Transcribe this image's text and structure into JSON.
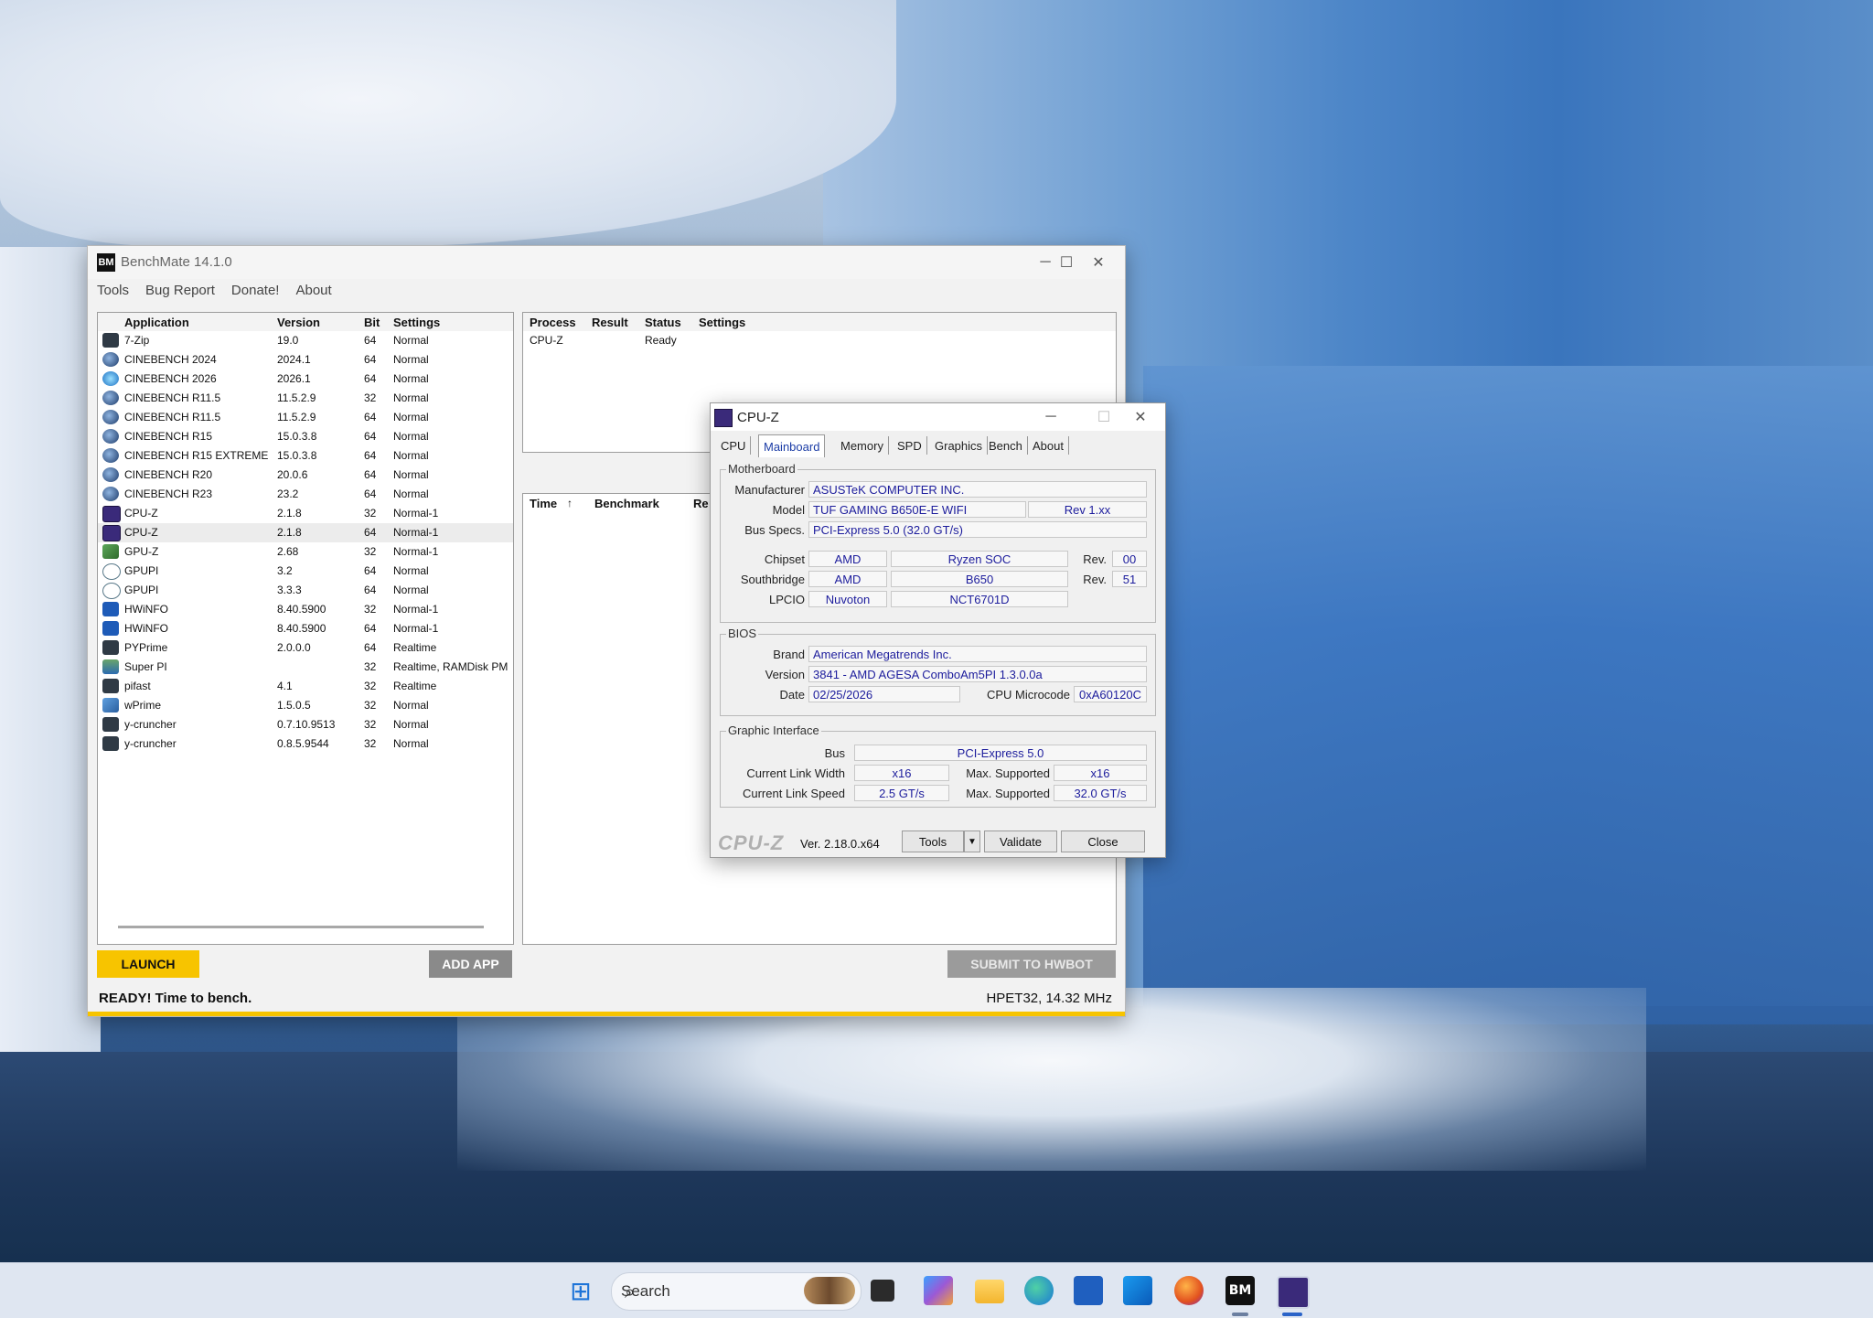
{
  "benchmate": {
    "title": "BenchMate 14.1.0",
    "menu": [
      "Tools",
      "Bug Report",
      "Donate!",
      "About"
    ],
    "apps_headers": [
      "Application",
      "Version",
      "Bit",
      "Settings"
    ],
    "apps": [
      {
        "name": "7-Zip",
        "version": "19.0",
        "bit": "64",
        "settings": "Normal",
        "icon": "terminal"
      },
      {
        "name": "CINEBENCH 2024",
        "version": "2024.1",
        "bit": "64",
        "settings": "Normal",
        "icon": "cinebench"
      },
      {
        "name": "CINEBENCH 2026",
        "version": "2026.1",
        "bit": "64",
        "settings": "Normal",
        "icon": "cinebench-new"
      },
      {
        "name": "CINEBENCH R11.5",
        "version": "11.5.2.9",
        "bit": "32",
        "settings": "Normal",
        "icon": "cinebench"
      },
      {
        "name": "CINEBENCH R11.5",
        "version": "11.5.2.9",
        "bit": "64",
        "settings": "Normal",
        "icon": "cinebench"
      },
      {
        "name": "CINEBENCH R15",
        "version": "15.0.3.8",
        "bit": "64",
        "settings": "Normal",
        "icon": "cinebench"
      },
      {
        "name": "CINEBENCH R15 EXTREME",
        "version": "15.0.3.8",
        "bit": "64",
        "settings": "Normal",
        "icon": "cinebench"
      },
      {
        "name": "CINEBENCH R20",
        "version": "20.0.6",
        "bit": "64",
        "settings": "Normal",
        "icon": "cinebench"
      },
      {
        "name": "CINEBENCH R23",
        "version": "23.2",
        "bit": "64",
        "settings": "Normal",
        "icon": "cinebench"
      },
      {
        "name": "CPU-Z",
        "version": "2.1.8",
        "bit": "32",
        "settings": "Normal-1",
        "icon": "cpuz"
      },
      {
        "name": "CPU-Z",
        "version": "2.1.8",
        "bit": "64",
        "settings": "Normal-1",
        "icon": "cpuz"
      },
      {
        "name": "GPU-Z",
        "version": "2.68",
        "bit": "32",
        "settings": "Normal-1",
        "icon": "gpuz"
      },
      {
        "name": "GPUPI",
        "version": "3.2",
        "bit": "64",
        "settings": "Normal",
        "icon": "pi"
      },
      {
        "name": "GPUPI",
        "version": "3.3.3",
        "bit": "64",
        "settings": "Normal",
        "icon": "pi"
      },
      {
        "name": "HWiNFO",
        "version": "8.40.5900",
        "bit": "32",
        "settings": "Normal-1",
        "icon": "hwinfo"
      },
      {
        "name": "HWiNFO",
        "version": "8.40.5900",
        "bit": "64",
        "settings": "Normal-1",
        "icon": "hwinfo"
      },
      {
        "name": "PYPrime",
        "version": "2.0.0.0",
        "bit": "64",
        "settings": "Realtime",
        "icon": "terminal"
      },
      {
        "name": "Super PI",
        "version": "",
        "bit": "32",
        "settings": "Realtime, RAMDisk PM",
        "icon": "superpi"
      },
      {
        "name": "pifast",
        "version": "4.1",
        "bit": "32",
        "settings": "Realtime",
        "icon": "terminal"
      },
      {
        "name": "wPrime",
        "version": "1.5.0.5",
        "bit": "32",
        "settings": "Normal",
        "icon": "wprime"
      },
      {
        "name": "y-cruncher",
        "version": "0.7.10.9513",
        "bit": "32",
        "settings": "Normal",
        "icon": "terminal"
      },
      {
        "name": "y-cruncher",
        "version": "0.8.5.9544",
        "bit": "32",
        "settings": "Normal",
        "icon": "terminal"
      }
    ],
    "process_headers": [
      "Process",
      "Result",
      "Status",
      "Settings"
    ],
    "processes": [
      {
        "process": "CPU-Z",
        "result": "",
        "status": "Ready",
        "settings": ""
      }
    ],
    "results_headers": [
      "Time",
      "Benchmark",
      "Re"
    ],
    "launch_label": "LAUNCH",
    "add_app_label": "ADD APP",
    "submit_label": "SUBMIT TO HWBOT",
    "status_text": "READY! Time to bench.",
    "timer_text": "HPET32, 14.32 MHz",
    "accent_color": "#f7c400"
  },
  "cpuz": {
    "title": "CPU-Z",
    "tabs": [
      "CPU",
      "Mainboard",
      "Memory",
      "SPD",
      "Graphics",
      "Bench",
      "About"
    ],
    "active_tab": "Mainboard",
    "motherboard": {
      "group": "Motherboard",
      "manufacturer_label": "Manufacturer",
      "manufacturer": "ASUSTeK COMPUTER INC.",
      "model_label": "Model",
      "model": "TUF GAMING B650E-E WIFI",
      "model_rev": "Rev 1.xx",
      "bus_label": "Bus Specs.",
      "bus": "PCI-Express 5.0 (32.0 GT/s)",
      "chipset_label": "Chipset",
      "chipset_vendor": "AMD",
      "chipset_name": "Ryzen SOC",
      "chipset_rev_label": "Rev.",
      "chipset_rev": "00",
      "southbridge_label": "Southbridge",
      "sb_vendor": "AMD",
      "sb_name": "B650",
      "sb_rev_label": "Rev.",
      "sb_rev": "51",
      "lpcio_label": "LPCIO",
      "lpcio_vendor": "Nuvoton",
      "lpcio_name": "NCT6701D"
    },
    "bios": {
      "group": "BIOS",
      "brand_label": "Brand",
      "brand": "American Megatrends Inc.",
      "version_label": "Version",
      "version": "3841 - AMD AGESA ComboAm5PI 1.3.0.0a",
      "date_label": "Date",
      "date": "02/25/2026",
      "microcode_label": "CPU Microcode",
      "microcode": "0xA60120C"
    },
    "graphic": {
      "group": "Graphic Interface",
      "bus_label": "Bus",
      "bus": "PCI-Express 5.0",
      "width_label": "Current Link Width",
      "width": "x16",
      "width_max_label": "Max. Supported",
      "width_max": "x16",
      "speed_label": "Current Link Speed",
      "speed": "2.5 GT/s",
      "speed_max_label": "Max. Supported",
      "speed_max": "32.0 GT/s"
    },
    "footer": {
      "logo": "CPU-Z",
      "version": "Ver. 2.18.0.x64",
      "tools_label": "Tools",
      "validate_label": "Validate",
      "close_label": "Close"
    }
  },
  "taskbar": {
    "search_label": "Search",
    "apps": [
      "start-icon",
      "search",
      "terminal-icon",
      "m365-icon",
      "file-explorer-icon",
      "edge-icon",
      "store-icon",
      "outlook-icon",
      "firefox-icon",
      "benchmate-icon",
      "cpuz-icon"
    ]
  }
}
